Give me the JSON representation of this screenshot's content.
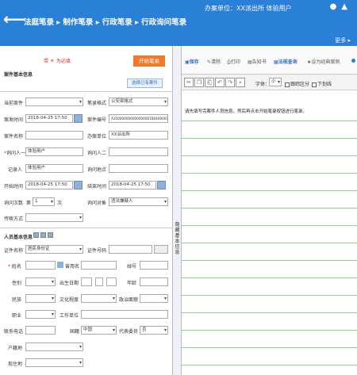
{
  "header": {
    "breadcrumb": "法庭笔录 ▸ 制作笔录 ▸ 行政笔录 ▸ 行政询问笔录",
    "unit": "办案单位：XX派出所  体验用户",
    "icons": [
      "chat-icon",
      "user-icon"
    ],
    "more": "更多 ▸"
  },
  "left": {
    "mark_label": "带 ＊ 为必填",
    "start_button": "开始笔录",
    "section_case": "案件基本信息",
    "select_case_button": "选择已有案件",
    "fields": {
      "current_case": {
        "label": "当前案件",
        "value": ""
      },
      "record_format": {
        "label": "笔录格式",
        "value": "公安部格式"
      },
      "case_time": {
        "label": "案发时间",
        "value": "2018-04-25 17:50"
      },
      "case_number": {
        "label": "案件编号",
        "value": "A35000000000000000180400001"
      },
      "case_name": {
        "label": "案件名称",
        "value": ""
      },
      "handling_unit": {
        "label": "办案单位",
        "value": "XX派出所"
      },
      "inquirer1": {
        "label": "询问人一",
        "value": "体验用户"
      },
      "inquirer2": {
        "label": "询问人二",
        "value": ""
      },
      "recorder": {
        "label": "记录人",
        "value": "体验用户"
      },
      "inquiry_place": {
        "label": "询问地点",
        "value": ""
      },
      "start_time": {
        "label": "开始时间",
        "value": "2018-04-25 17:50"
      },
      "end_time": {
        "label": "结束时间",
        "value": "2018-04-25 17:50"
      },
      "inquiry_count": {
        "label": "询问次数",
        "prefix": "第",
        "value": "1",
        "suffix": "次"
      },
      "inquiry_target": {
        "label": "询问对象",
        "value": "违法嫌疑人"
      },
      "summon_method": {
        "label": "传唤方式",
        "value": ""
      }
    },
    "section_person": "人员基本信息",
    "person": {
      "id_type": {
        "label": "证件名称",
        "value": "居民身份证"
      },
      "id_number": {
        "label": "证件号码",
        "value": ""
      },
      "name": {
        "label": "姓名",
        "value": ""
      },
      "alias": {
        "label": "曾用名",
        "value": ""
      },
      "nickname": {
        "label": "绰号",
        "value": ""
      },
      "gender": {
        "label": "性别",
        "value": ""
      },
      "birth_date": {
        "label": "出生日期",
        "value": ""
      },
      "age": {
        "label": "年龄",
        "value": ""
      },
      "ethnicity": {
        "label": "民族",
        "value": ""
      },
      "education": {
        "label": "文化程度",
        "value": ""
      },
      "political": {
        "label": "政治面貌",
        "value": ""
      },
      "occupation": {
        "label": "职业",
        "value": ""
      },
      "workplace": {
        "label": "工作单位",
        "value": ""
      },
      "contact": {
        "label": "联系电话",
        "value": ""
      },
      "nationality": {
        "label": "国籍",
        "value": "中国"
      },
      "representative": {
        "label": "代表委员",
        "value": "否"
      },
      "household": {
        "label": "户籍地",
        "value": ""
      },
      "residence": {
        "label": "现住地",
        "value": ""
      }
    },
    "divider_label": "隐藏基本信息"
  },
  "right": {
    "toolbar": [
      {
        "name": "save",
        "label": "保存",
        "active": true
      },
      {
        "name": "clear",
        "label": "清除",
        "active": false
      },
      {
        "name": "print",
        "label": "打印",
        "active": false
      },
      {
        "name": "notice",
        "label": "告知书",
        "active": false
      },
      {
        "name": "law-query",
        "label": "法规查询",
        "active": true
      },
      {
        "name": "set-classic",
        "label": "设为经典案例",
        "active": false
      }
    ],
    "font_label": "字体：",
    "font_size": "小",
    "page_split_label": "跟踪区分",
    "wrap_label": "下划线",
    "hint": "请先填写完案件人员信息，然后再点击开始笔录按钮进行笔录。"
  }
}
